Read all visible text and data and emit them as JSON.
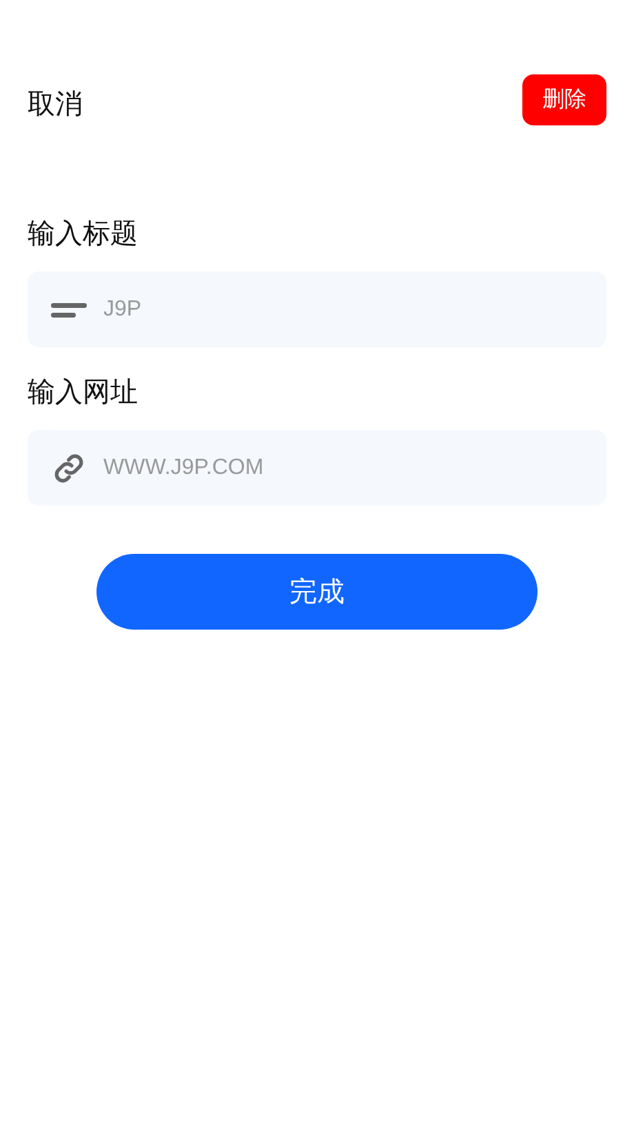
{
  "header": {
    "cancel": "取消",
    "delete": "删除"
  },
  "fields": [
    {
      "label": "输入标题",
      "kind": "title",
      "placeholder": "J9P"
    },
    {
      "label": "输入网址",
      "kind": "url",
      "placeholder": "WWW.J9P.COM"
    }
  ],
  "submit": "完成"
}
